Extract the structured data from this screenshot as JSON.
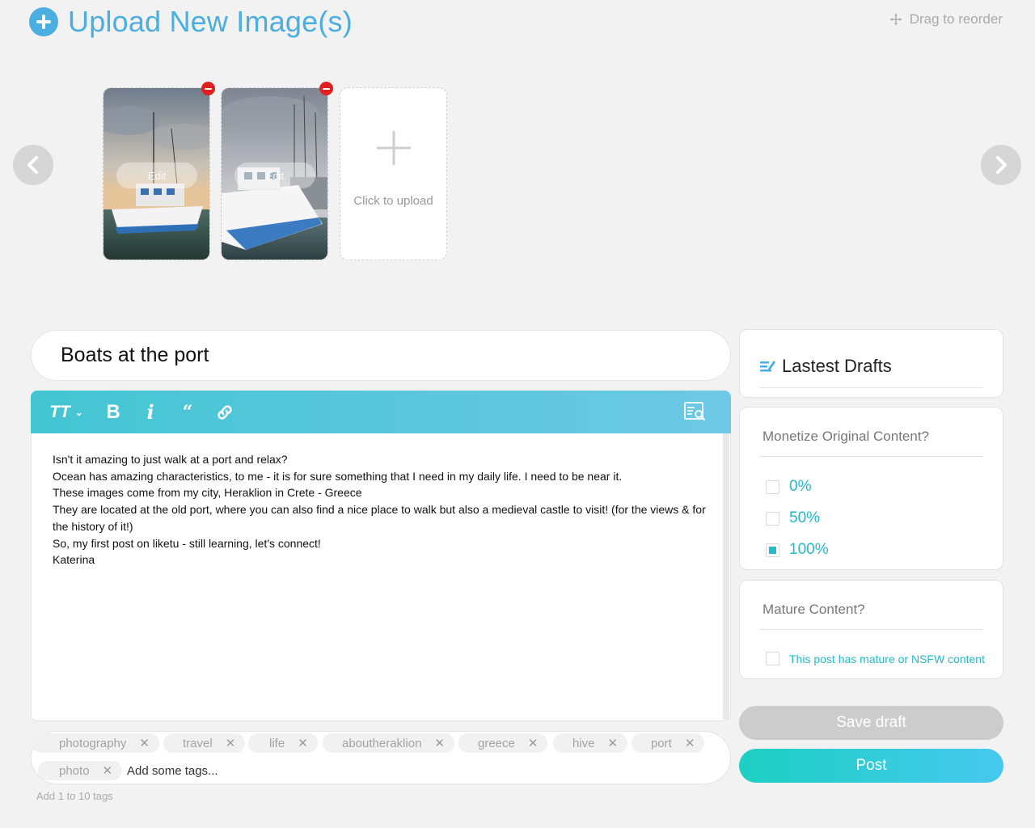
{
  "header": {
    "title": "Upload New Image(s)",
    "icon": "plus-circle-icon"
  },
  "reorder": {
    "label": "Drag to reorder",
    "icon": "move-icon"
  },
  "carousel": {
    "images": [
      {
        "edit_label": "Edit"
      },
      {
        "edit_label": "Edit"
      }
    ],
    "upload_label": "Click to upload"
  },
  "post": {
    "title": "Boats at the port",
    "body_lines": [
      "Isn't it amazing to just walk at a port and relax?",
      "Ocean has amazing characteristics, to me - it is for sure something that I need in my daily life. I need to be near it.",
      "These images come from my city, Heraklion in Crete - Greece",
      "They are located at the old port, where you can also find a nice place to walk but also a medieval castle to visit! (for the views & for the history of it!)",
      "So, my first post on liketu - still learning, let's connect!",
      "Katerina"
    ]
  },
  "toolbar": {
    "size_label": "TT",
    "bold_label": "B",
    "italic_label": "i",
    "quote_label": "“"
  },
  "tags": {
    "items": [
      "photography",
      "travel",
      "life",
      "aboutheraklion",
      "greece",
      "hive",
      "port",
      "photo"
    ],
    "placeholder": "Add some tags...",
    "hint": "Add 1 to 10 tags"
  },
  "drafts": {
    "title": "Lastest Drafts"
  },
  "monetize": {
    "title": "Monetize Original Content?",
    "options": [
      {
        "label": "0%",
        "checked": false
      },
      {
        "label": "50%",
        "checked": false
      },
      {
        "label": "100%",
        "checked": true
      }
    ]
  },
  "mature": {
    "title": "Mature Content?",
    "option_label": "This post has mature or NSFW content",
    "checked": false
  },
  "actions": {
    "save_draft": "Save draft",
    "post": "Post"
  },
  "colors": {
    "accent": "#25b9c9",
    "header_blue": "#4aaee0",
    "remove_red": "#e02020"
  }
}
